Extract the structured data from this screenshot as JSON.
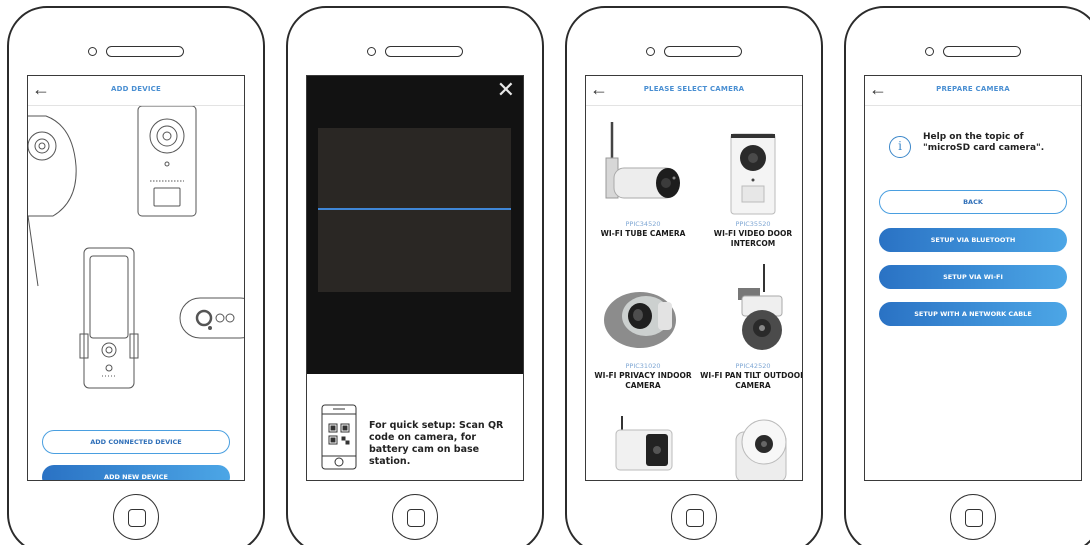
{
  "screen1": {
    "title": "ADD DEVICE",
    "add_connected_label": "ADD CONNECTED DEVICE",
    "add_new_label": "ADD NEW DEVICE"
  },
  "screen2": {
    "close_symbol": "✕",
    "hint": "For quick setup: Scan QR code on camera, for battery cam on base station."
  },
  "screen3": {
    "title": "PLEASE SELECT CAMERA",
    "cameras": [
      {
        "model": "PPIC34520",
        "name": "WI-FI TUBE CAMERA"
      },
      {
        "model": "PPIC35520",
        "name": "WI-FI VIDEO DOOR INTERCOM"
      },
      {
        "model": "PPIC31020",
        "name": "WI-FI PRIVACY INDOOR CAMERA"
      },
      {
        "model": "PPIC42520",
        "name": "WI-FI PAN TILT OUTDOOR CAMERA"
      }
    ]
  },
  "screen4": {
    "title": "PREPARE CAMERA",
    "info_text": "Help on the topic of \"microSD card camera\".",
    "info_symbol": "i",
    "buttons": [
      "BACK",
      "SETUP VIA BLUETOOTH",
      "SETUP VIA WI-FI",
      "SETUP WITH A NETWORK CABLE"
    ]
  },
  "colors": {
    "accent": "#4a8fd2",
    "button_gradient_start": "#2a72c4",
    "button_gradient_end": "#4ca6e6",
    "scanner_bg": "#121212",
    "scan_line": "#3f86d6"
  },
  "icons": [
    "back-arrow-icon",
    "close-icon",
    "qr-phone-icon",
    "info-icon",
    "home-button-icon"
  ]
}
